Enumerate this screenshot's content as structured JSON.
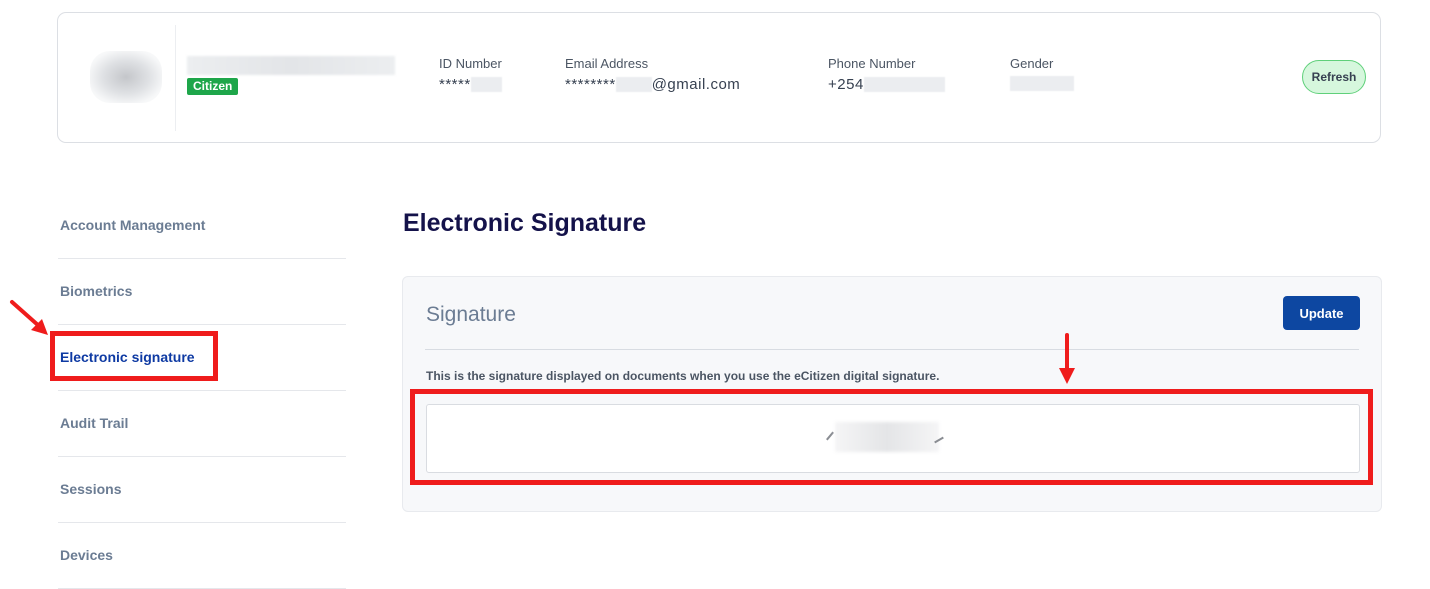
{
  "profile": {
    "badge": "Citizen",
    "id_number": {
      "label": "ID Number",
      "value": "*****"
    },
    "email": {
      "label": "Email Address",
      "value_prefix": "********",
      "value_suffix": "@gmail.com"
    },
    "phone": {
      "label": "Phone Number",
      "value": "+254"
    },
    "gender": {
      "label": "Gender"
    },
    "refresh_label": "Refresh"
  },
  "sidebar": {
    "items": [
      {
        "label": "Account Management",
        "active": false
      },
      {
        "label": "Biometrics",
        "active": false
      },
      {
        "label": "Electronic signature",
        "active": true
      },
      {
        "label": "Audit Trail",
        "active": false
      },
      {
        "label": "Sessions",
        "active": false
      },
      {
        "label": "Devices",
        "active": false
      }
    ]
  },
  "main": {
    "title": "Electronic Signature",
    "card": {
      "heading": "Signature",
      "update_label": "Update",
      "description": "This is the signature displayed on documents when you use the eCitizen digital signature."
    }
  },
  "colors": {
    "accent": "#0d47a1",
    "badge_green": "#1ea64a",
    "highlight_red": "#ef1c1c",
    "title_navy": "#14124a"
  }
}
